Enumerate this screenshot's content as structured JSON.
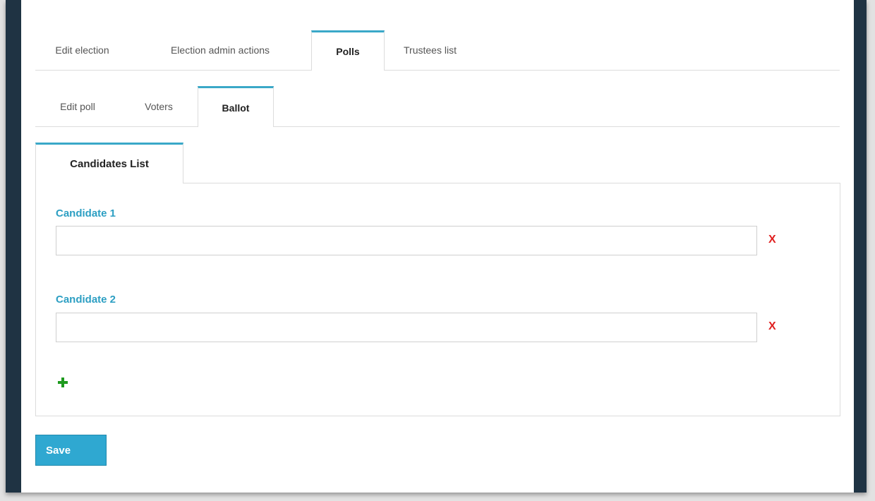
{
  "main_tabs": [
    {
      "label": "Edit election"
    },
    {
      "label": "Election admin actions"
    },
    {
      "label": "Polls",
      "active": true
    },
    {
      "label": "Trustees list"
    }
  ],
  "sub_tabs": [
    {
      "label": "Edit poll"
    },
    {
      "label": "Voters"
    },
    {
      "label": "Ballot",
      "active": true
    }
  ],
  "panel": {
    "tab_label": "Candidates List",
    "candidates": [
      {
        "label": "Candidate 1",
        "value": "",
        "remove": "X"
      },
      {
        "label": "Candidate 2",
        "value": "",
        "remove": "X"
      }
    ],
    "add_icon": "plus-icon"
  },
  "save_label": "Save",
  "colors": {
    "accent": "#3aa8c8",
    "label": "#2d9fc3",
    "remove": "#e02020",
    "add": "#1e9a1e",
    "button": "#2fa8d1",
    "frame": "#1f3343"
  }
}
